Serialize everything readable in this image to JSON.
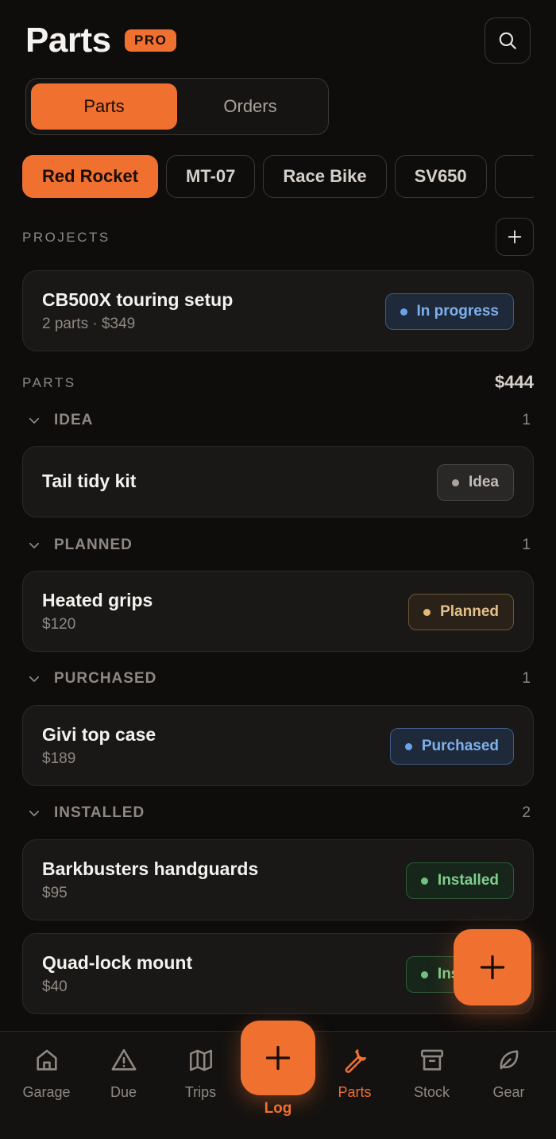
{
  "header": {
    "title": "Parts",
    "badge": "PRO",
    "search_icon": "search-icon"
  },
  "segments": [
    {
      "label": "Parts",
      "active": true
    },
    {
      "label": "Orders",
      "active": false
    }
  ],
  "vehicles": [
    "Red Rocket",
    "MT-07",
    "Race Bike",
    "SV650",
    ""
  ],
  "projects": {
    "label": "PROJECTS",
    "items": [
      {
        "title": "CB500X touring setup",
        "subtitle": "2 parts · $349",
        "status": "In progress"
      }
    ]
  },
  "parts": {
    "label": "PARTS",
    "total": "$444",
    "groups": [
      {
        "name": "IDEA",
        "count": "1",
        "items": [
          {
            "title": "Tail tidy kit",
            "price": "",
            "status": "Idea"
          }
        ]
      },
      {
        "name": "PLANNED",
        "count": "1",
        "items": [
          {
            "title": "Heated grips",
            "price": "$120",
            "status": "Planned"
          }
        ]
      },
      {
        "name": "PURCHASED",
        "count": "1",
        "items": [
          {
            "title": "Givi top case",
            "price": "$189",
            "status": "Purchased"
          }
        ]
      },
      {
        "name": "INSTALLED",
        "count": "2",
        "items": [
          {
            "title": "Barkbusters handguards",
            "price": "$95",
            "status": "Installed"
          },
          {
            "title": "Quad-lock mount",
            "price": "$40",
            "status": "Installed"
          }
        ]
      }
    ]
  },
  "bottom_nav": {
    "items": [
      {
        "label": "Garage",
        "icon": "home-icon"
      },
      {
        "label": "Due",
        "icon": "warning-icon"
      },
      {
        "label": "Trips",
        "icon": "map-icon"
      },
      {
        "label": "Parts",
        "icon": "wrench-icon",
        "active": true
      },
      {
        "label": "Stock",
        "icon": "archive-icon"
      },
      {
        "label": "Gear",
        "icon": "leaf-icon"
      }
    ],
    "log_label": "Log"
  },
  "colors": {
    "accent": "#f07030",
    "background": "#0f0d0c",
    "card": "#1a1816"
  }
}
